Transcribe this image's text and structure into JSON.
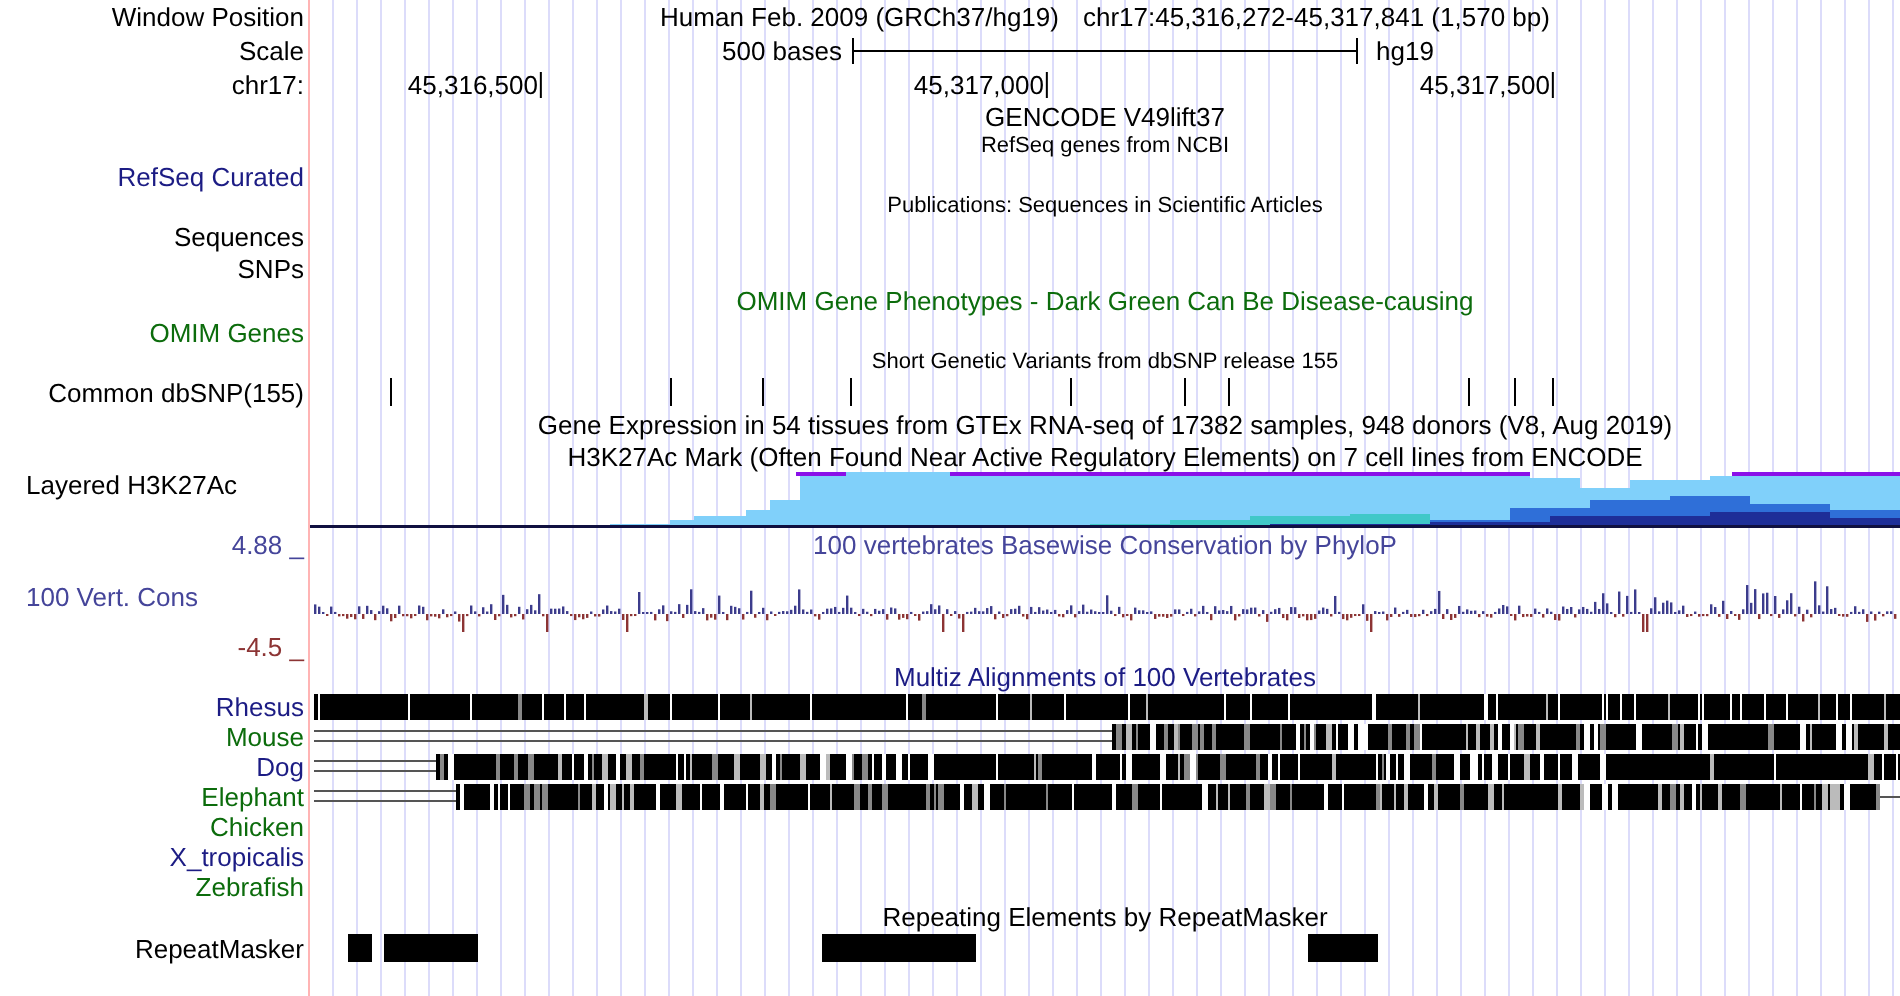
{
  "header": {
    "label": "Window Position",
    "title": "Human Feb. 2009 (GRCh37/hg19)",
    "position": "chr17:45,316,272-45,317,841 (1,570 bp)"
  },
  "scale": {
    "label": "Scale",
    "bar_label": "500 bases",
    "assembly": "hg19"
  },
  "ruler": {
    "label": "chr17:",
    "ticks": [
      "45,316,500",
      "45,317,000",
      "45,317,500"
    ]
  },
  "gencode": {
    "title": "GENCODE V49lift37"
  },
  "refseq": {
    "title": "RefSeq genes from NCBI",
    "label": "RefSeq Curated"
  },
  "publications": {
    "title": "Publications: Sequences in Scientific Articles",
    "labels": [
      "Sequences",
      "SNPs"
    ]
  },
  "omim": {
    "title": "OMIM Gene Phenotypes - Dark Green Can Be Disease-causing",
    "label": "OMIM Genes"
  },
  "dbsnp": {
    "title": "Short Genetic Variants from dbSNP release 155",
    "label": "Common dbSNP(155)"
  },
  "gtex": {
    "title": "Gene Expression in 54 tissues from GTEx RNA-seq of 17382 samples, 948 donors (V8, Aug 2019)"
  },
  "h3k27ac": {
    "title": "H3K27Ac Mark (Often Found Near Active Regulatory Elements) on 7 cell lines from ENCODE",
    "label": "Layered H3K27Ac"
  },
  "phylop": {
    "title": "100 vertebrates Basewise Conservation by PhyloP",
    "label": "100 Vert. Cons",
    "max": "4.88 _",
    "min": "-4.5 _"
  },
  "multiz": {
    "title": "Multiz Alignments of 100 Vertebrates",
    "species": [
      {
        "name": "Rhesus",
        "color": "#1c1c84"
      },
      {
        "name": "Mouse",
        "color": "#0c6c0c"
      },
      {
        "name": "Dog",
        "color": "#1c1c84"
      },
      {
        "name": "Elephant",
        "color": "#0c6c0c"
      },
      {
        "name": "Chicken",
        "color": "#0c6c0c"
      },
      {
        "name": "X_tropicalis",
        "color": "#1c1c84"
      },
      {
        "name": "Zebrafish",
        "color": "#0c6c0c"
      }
    ]
  },
  "repeatmasker": {
    "title": "Repeating Elements by RepeatMasker",
    "label": "RepeatMasker"
  }
}
